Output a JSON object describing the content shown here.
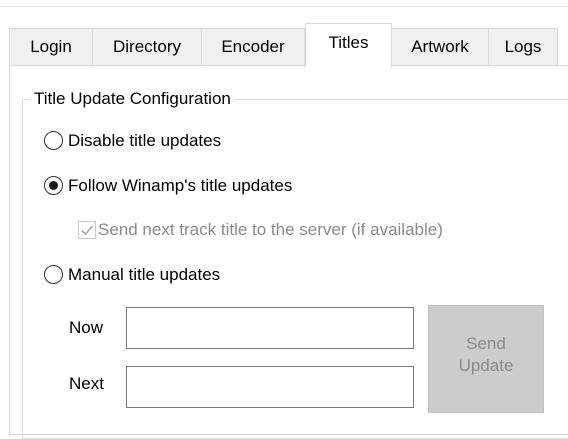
{
  "tabs": [
    {
      "label": "Login",
      "selected": false
    },
    {
      "label": "Directory",
      "selected": false
    },
    {
      "label": "Encoder",
      "selected": false
    },
    {
      "label": "Titles",
      "selected": true
    },
    {
      "label": "Artwork",
      "selected": false
    },
    {
      "label": "Logs",
      "selected": false
    }
  ],
  "group": {
    "title": "Title Update Configuration"
  },
  "options": {
    "disable": {
      "label": "Disable title updates",
      "checked": false
    },
    "follow": {
      "label": "Follow Winamp's title updates",
      "checked": true
    },
    "send_next": {
      "label": "Send next track title to the server (if available)",
      "checked": true,
      "enabled": false
    },
    "manual": {
      "label": "Manual title updates",
      "checked": false
    }
  },
  "manual_fields": {
    "now_label": "Now",
    "now_value": "",
    "next_label": "Next",
    "next_value": ""
  },
  "send_button": {
    "line1": "Send",
    "line2": "Update",
    "enabled": false
  },
  "colors": {
    "disabled_text": "#8a8a8a",
    "border": "#d9d9d9",
    "button_face": "#cccccc"
  }
}
